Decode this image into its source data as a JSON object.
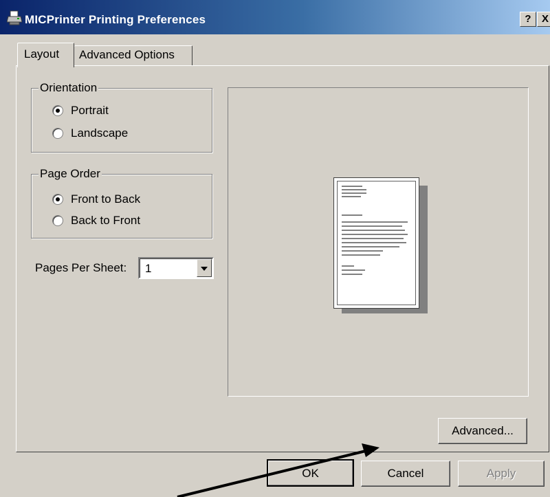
{
  "window": {
    "title": "MICPrinter Printing Preferences",
    "help_label": "?",
    "close_label": "X"
  },
  "tabs": [
    {
      "label": "Layout",
      "active": true
    },
    {
      "label": "Advanced Options",
      "active": false
    }
  ],
  "orientation": {
    "legend": "Orientation",
    "options": [
      {
        "label": "Portrait",
        "selected": true
      },
      {
        "label": "Landscape",
        "selected": false
      }
    ]
  },
  "page_order": {
    "legend": "Page Order",
    "options": [
      {
        "label": "Front to Back",
        "selected": true
      },
      {
        "label": "Back to Front",
        "selected": false
      }
    ]
  },
  "pages_per_sheet": {
    "label": "Pages Per Sheet:",
    "value": "1"
  },
  "buttons": {
    "advanced": "Advanced...",
    "ok": "OK",
    "cancel": "Cancel",
    "apply": "Apply"
  },
  "colors": {
    "title_gradient_start": "#0a246a",
    "title_gradient_end": "#a6caf0",
    "face": "#d4d0c8",
    "annotation_arrow": "#000000"
  }
}
